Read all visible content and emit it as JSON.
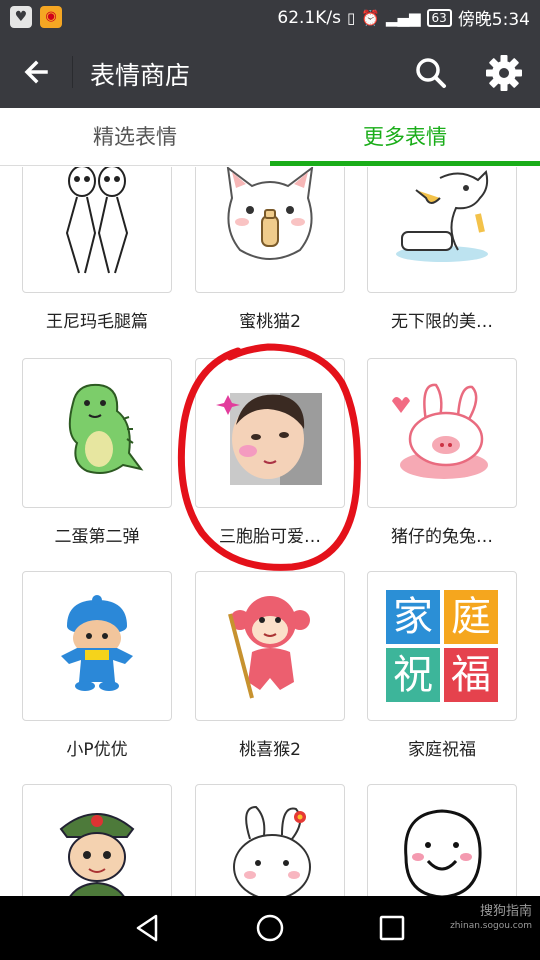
{
  "status_bar": {
    "network_speed": "62.1K/s",
    "battery": "63",
    "time": "傍晚5:34"
  },
  "header": {
    "title": "表情商店"
  },
  "tabs": [
    {
      "label": "精选表情",
      "active": false
    },
    {
      "label": "更多表情",
      "active": true
    }
  ],
  "colors": {
    "header_bg": "#393a3f",
    "accent_green": "#1aad19",
    "circle_red": "#e4111a"
  },
  "stickers": [
    {
      "label": "王尼玛毛腿篇",
      "icon": "leggy-figures-sticker-icon"
    },
    {
      "label": "蜜桃猫2",
      "icon": "peach-cat-sticker-icon"
    },
    {
      "label": "无下限的美…",
      "icon": "dog-bathtub-sticker-icon"
    },
    {
      "label": "二蛋第二弹",
      "icon": "green-dinosaur-sticker-icon"
    },
    {
      "label": "三胞胎可爱…",
      "icon": "baby-photo-sticker-icon"
    },
    {
      "label": "猪仔的兔兔…",
      "icon": "pig-bunny-sticker-icon"
    },
    {
      "label": "小P优优",
      "icon": "pocoyo-sticker-icon"
    },
    {
      "label": "桃喜猴2",
      "icon": "pink-monkey-sticker-icon"
    },
    {
      "label": "家庭祝福",
      "icon": "family-blessing-sticker-icon",
      "tiles": [
        "家",
        "庭",
        "祝",
        "福"
      ]
    },
    {
      "label": "",
      "icon": "soldier-boy-sticker-icon"
    },
    {
      "label": "",
      "icon": "white-bunny-sticker-icon"
    },
    {
      "label": "",
      "icon": "doodle-face-sticker-icon"
    }
  ],
  "watermark": {
    "line1": "搜狗指南",
    "line2": "zhinan.sogou.com"
  }
}
